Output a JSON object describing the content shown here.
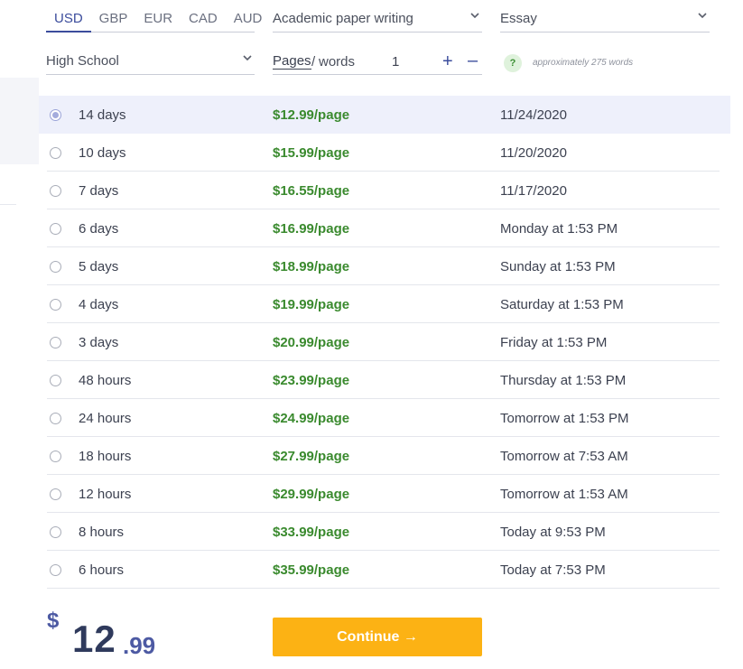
{
  "currency": {
    "options": [
      "USD",
      "GBP",
      "EUR",
      "CAD",
      "AUD"
    ],
    "selected": "USD"
  },
  "selects": {
    "type_of_service": "Academic paper writing",
    "paper_type": "Essay",
    "academic_level": "High School"
  },
  "pages": {
    "pages_label": "Pages",
    "separator": "/",
    "words_label": "words",
    "count": "1",
    "plus": "+",
    "minus": "–"
  },
  "help": {
    "icon": "?",
    "approx_text": "approximately 275 words"
  },
  "deadlines": [
    {
      "duration": "14 days",
      "price": "$12.99",
      "unit": "/page",
      "date": "11/24/2020",
      "selected": true
    },
    {
      "duration": "10 days",
      "price": "$15.99",
      "unit": "/page",
      "date": "11/20/2020",
      "selected": false
    },
    {
      "duration": "7 days",
      "price": "$16.55",
      "unit": "/page",
      "date": "11/17/2020",
      "selected": false
    },
    {
      "duration": "6 days",
      "price": "$16.99",
      "unit": "/page",
      "date": "Monday at 1:53 PM",
      "selected": false
    },
    {
      "duration": "5 days",
      "price": "$18.99",
      "unit": "/page",
      "date": "Sunday at 1:53 PM",
      "selected": false
    },
    {
      "duration": "4 days",
      "price": "$19.99",
      "unit": "/page",
      "date": "Saturday at 1:53 PM",
      "selected": false
    },
    {
      "duration": "3 days",
      "price": "$20.99",
      "unit": "/page",
      "date": "Friday at 1:53 PM",
      "selected": false
    },
    {
      "duration": "48 hours",
      "price": "$23.99",
      "unit": "/page",
      "date": "Thursday at 1:53 PM",
      "selected": false
    },
    {
      "duration": "24 hours",
      "price": "$24.99",
      "unit": "/page",
      "date": "Tomorrow at 1:53 PM",
      "selected": false
    },
    {
      "duration": "18 hours",
      "price": "$27.99",
      "unit": "/page",
      "date": "Tomorrow at 7:53 AM",
      "selected": false
    },
    {
      "duration": "12 hours",
      "price": "$29.99",
      "unit": "/page",
      "date": "Tomorrow at 1:53 AM",
      "selected": false
    },
    {
      "duration": "8 hours",
      "price": "$33.99",
      "unit": "/page",
      "date": "Today at 9:53 PM",
      "selected": false
    },
    {
      "duration": "6 hours",
      "price": "$35.99",
      "unit": "/page",
      "date": "Today at 7:53 PM",
      "selected": false
    }
  ],
  "total": {
    "symbol": "$",
    "integer": "12",
    "decimal": ".99"
  },
  "continue_label": "Continue →",
  "colors": {
    "accent": "#3b4c9c",
    "price_green": "#3a8a2e",
    "button": "#fcb214",
    "selected_row": "#eef0fb"
  }
}
